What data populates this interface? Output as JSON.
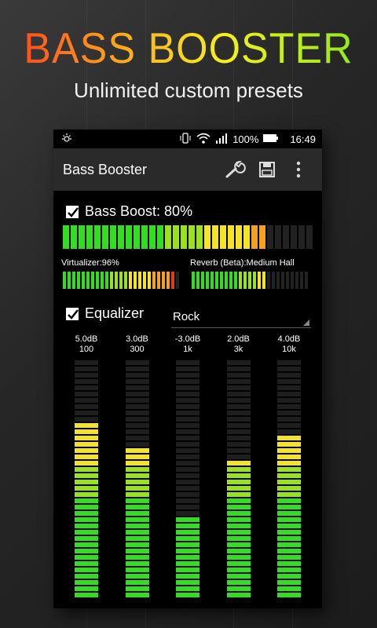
{
  "promo": {
    "title": "BASS BOOSTER",
    "subtitle": "Unlimited custom presets"
  },
  "statusbar": {
    "battery": "100%",
    "time": "16:49"
  },
  "actionbar": {
    "title": "Bass Booster"
  },
  "bass_boost": {
    "label": "Bass Boost: 80%",
    "checked": true,
    "level": 0.8
  },
  "virtualizer": {
    "label": "Virtualizer:96%",
    "level": 0.96
  },
  "reverb": {
    "label": "Reverb (Beta):Medium Hall",
    "level": 0.62
  },
  "equalizer": {
    "label": "Equalizer",
    "checked": true,
    "preset": "Rock",
    "bands": [
      {
        "gain": "5.0dB",
        "freq": "100",
        "level": 0.74
      },
      {
        "gain": "3.0dB",
        "freq": "300",
        "level": 0.64
      },
      {
        "gain": "-3.0dB",
        "freq": "1k",
        "level": 0.34
      },
      {
        "gain": "2.0dB",
        "freq": "3k",
        "level": 0.58
      },
      {
        "gain": "4.0dB",
        "freq": "10k",
        "level": 0.69
      }
    ]
  },
  "colors": {
    "green": "#33dd22",
    "yellow": "#f5e426",
    "orange": "#f5a020",
    "red": "#e83a14",
    "off": "#222222"
  }
}
